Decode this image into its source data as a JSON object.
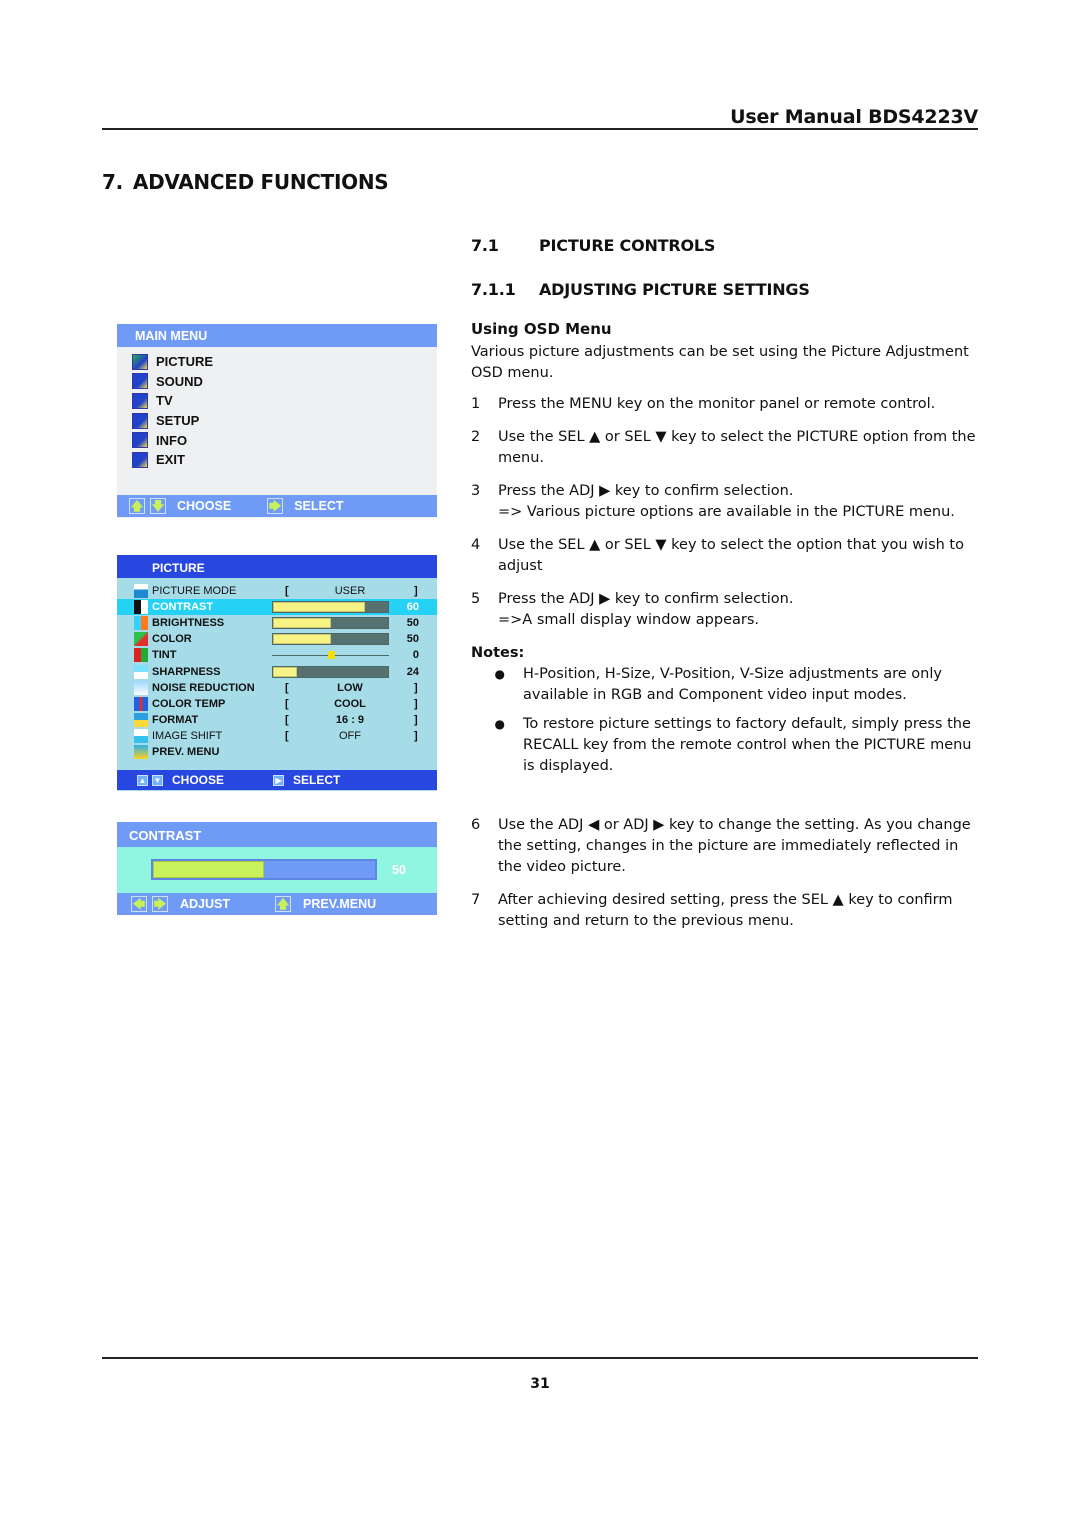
{
  "header": {
    "title": "User Manual BDS4223V"
  },
  "chapter": {
    "number": "7.",
    "title": "ADVANCED FUNCTIONS"
  },
  "sections": [
    {
      "number": "7.1",
      "title": "PICTURE CONTROLS"
    },
    {
      "number": "7.1.1",
      "title": "ADJUSTING PICTURE SETTINGS"
    }
  ],
  "content": {
    "subheading": "Using OSD Menu",
    "intro": "Various picture adjustments can be set using the Picture Adjustment OSD menu.",
    "steps_a": [
      {
        "n": "1",
        "text": "Press the MENU key on the monitor panel or remote control."
      },
      {
        "n": "2",
        "text": "Use the SEL ▲ or SEL ▼ key to select the PICTURE option from the menu."
      },
      {
        "n": "3",
        "text": "Press the ADJ ▶ key to confirm selection.",
        "result": "=> Various picture options are available in the PICTURE menu."
      },
      {
        "n": "4",
        "text": "Use the SEL ▲ or SEL ▼ key to select the option that you wish to adjust"
      },
      {
        "n": "5",
        "text": " Press the ADJ ▶ key to confirm selection.",
        "result": "=>A small display window appears."
      }
    ],
    "notes_heading": "Notes:",
    "notes": [
      "H-Position, H-Size, V-Position, V-Size adjustments are only available in RGB and Component video input modes.",
      "To restore picture settings to factory default, simply press the RECALL key from the remote control when the PICTURE menu is displayed."
    ],
    "steps_b": [
      {
        "n": "6",
        "text": "Use the ADJ ◀ or ADJ ▶ key to change the setting. As you change the setting, changes in the picture are immediately reflected in the video picture."
      },
      {
        "n": "7",
        "text": "After achieving desired setting, press the SEL ▲ key to confirm setting and return to the previous menu."
      }
    ]
  },
  "main_menu": {
    "title": "MAIN  MENU",
    "items": [
      {
        "label": "PICTURE",
        "icon": "picture-icon"
      },
      {
        "label": "SOUND",
        "icon": "sound-icon"
      },
      {
        "label": "TV",
        "icon": "tv-icon"
      },
      {
        "label": "SETUP",
        "icon": "setup-icon"
      },
      {
        "label": "INFO",
        "icon": "info-icon"
      },
      {
        "label": "EXIT",
        "icon": "exit-icon"
      }
    ],
    "footer": {
      "choose": "CHOOSE",
      "select": "SELECT"
    }
  },
  "picture_menu": {
    "title": "PICTURE",
    "rows": [
      {
        "label": "PICTURE MODE",
        "type": "option",
        "value": "USER",
        "light": true
      },
      {
        "label": "CONTRAST",
        "type": "slider",
        "value": "60",
        "fraction": 0.8,
        "highlighted": true
      },
      {
        "label": "BRIGHTNESS",
        "type": "slider",
        "value": "50",
        "fraction": 0.5
      },
      {
        "label": "COLOR",
        "type": "slider",
        "value": "50",
        "fraction": 0.5
      },
      {
        "label": "TINT",
        "type": "center",
        "value": "0",
        "fraction": 0.5
      },
      {
        "label": "SHARPNESS",
        "type": "slider",
        "value": "24",
        "fraction": 0.21
      },
      {
        "label": "NOISE  REDUCTION",
        "type": "option",
        "value": "LOW"
      },
      {
        "label": "COLOR  TEMP",
        "type": "option",
        "value": "COOL"
      },
      {
        "label": "FORMAT",
        "type": "option",
        "value": "16 : 9"
      },
      {
        "label": "IMAGE SHIFT",
        "type": "option",
        "value": "OFF",
        "light": true
      },
      {
        "label": "PREV.  MENU",
        "type": "link"
      }
    ],
    "footer": {
      "choose": "CHOOSE",
      "select": "SELECT"
    }
  },
  "contrast_window": {
    "title": "CONTRAST",
    "value": "50",
    "fraction": 0.5,
    "footer": {
      "adjust": "ADJUST",
      "prev": "PREV.MENU"
    }
  },
  "page_number": "31"
}
